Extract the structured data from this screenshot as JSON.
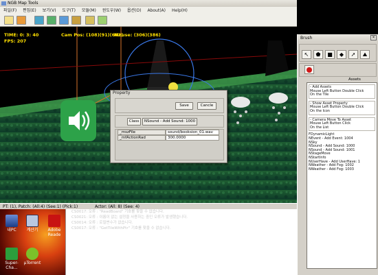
{
  "window": {
    "title": "NGB Map Tools",
    "menu": [
      "파일(F)",
      "편집(E)",
      "보기(V)",
      "도구(T)",
      "모듈(M)",
      "윈도우(W)",
      "옵션(O)",
      "About(A)",
      "Help(H)"
    ]
  },
  "hud": {
    "time": "TIME: 0: 3: 40",
    "fps": "FPS: 207",
    "cam": "Cam Pos: (108)(91)(662)",
    "mouse": "Mouse: (306)(386)"
  },
  "status": {
    "left": "PT: (1), Patch: (All:4) (See:1) (Pick:1)",
    "right": "Actor: (All: 8) (See: 4)"
  },
  "dialog": {
    "title": "Property",
    "save": "Save",
    "cancel": "Cancle",
    "class_button": "Class",
    "class_value": "NSound - Add Sound: 1000",
    "rows": [
      {
        "key": "_mszFile",
        "value": "sound/booksion_01.wav"
      },
      {
        "key": "_mfActionRad",
        "value": "300.0000"
      }
    ]
  },
  "brush": {
    "title": "Brush",
    "assets_label": "Assets",
    "help": [
      [
        "- Add Assets",
        "Mouse Left Button Double Click",
        "On the Tile"
      ],
      [
        "- Show Asset Property",
        "Mouse Left Button Double Click",
        "On the Icon"
      ],
      [
        "- Camera Move To Asset",
        "Mouse Left Button Click",
        "On the List"
      ]
    ],
    "list": [
      "FDynamicLight",
      "NEvent - Add Event: 1004",
      "NSky",
      "NSound - Add Sound: 1000",
      "NSound - Add Sound: 1001",
      "NStageMove",
      "NStartInfo",
      "NUserHave - Add UserHave: 1",
      "NWeather - Add Fog: 1002",
      "NWeather - Add Fog: 1003"
    ]
  },
  "desktop": {
    "icons": [
      "내PC",
      "계산기",
      "Adobe Reade",
      "Super-Cha...",
      "μTorrent"
    ]
  },
  "logs": [
    "CS0017: 오류 : \"ReadBoard\" 기호를 찾을 수 없습니다.",
    "CS0021: 오류 : 이름이 없는 설정을 사용하는 중인 오류가 발생했습니다.",
    "CS0014: 오류 : 로컬변수가 없습니다.",
    "CS0017: 오류 : \"GetTileWithPtr\" 기호를 찾을 수 없습니다."
  ],
  "colors": {
    "hud": "#ffe000",
    "sound_tile": "#2da249"
  }
}
